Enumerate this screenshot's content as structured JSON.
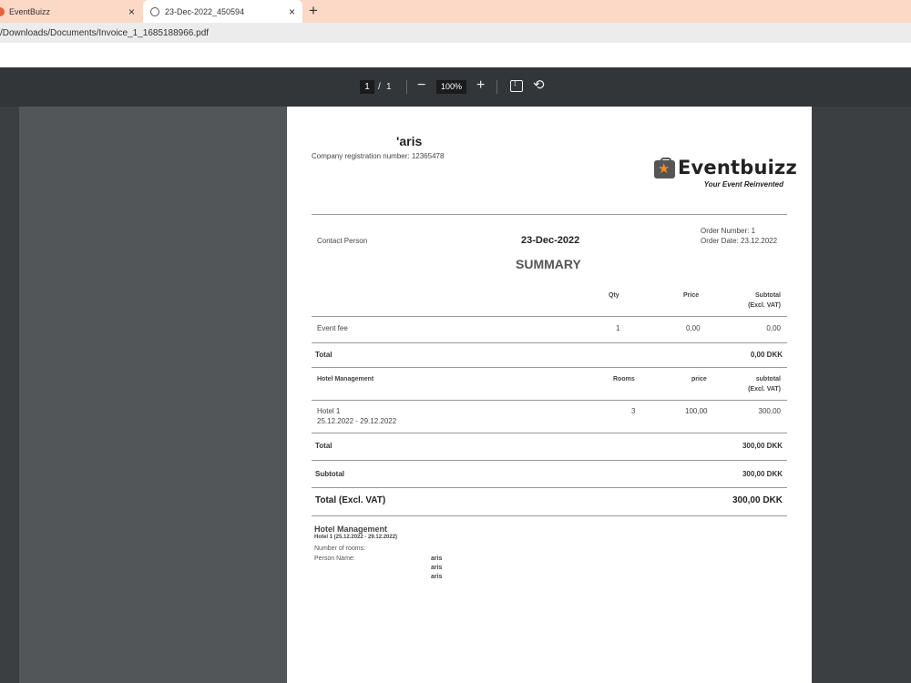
{
  "browser": {
    "tabs": [
      {
        "title": "EventBuizz"
      },
      {
        "title": "23-Dec-2022_450594"
      }
    ],
    "close_glyph": "×",
    "new_tab_glyph": "+",
    "url": "/Downloads/Documents/Invoice_1_1685188966.pdf"
  },
  "pdf_toolbar": {
    "page_current": "1",
    "page_separator": "/",
    "page_total": "1",
    "zoom_out_glyph": "−",
    "zoom": "100%",
    "zoom_in_glyph": "+",
    "rotate_glyph": "⟲"
  },
  "invoice": {
    "company_name": "'aris",
    "company_reg": "Company registration number: 12365478",
    "logo": {
      "name": "Eventbuizz",
      "tagline": "Your Event Reinvented",
      "star": "★"
    },
    "contact_person": "Contact Person",
    "date": "23-Dec-2022",
    "order_number": "Order Number: 1",
    "order_date": "Order Date: 23.12.2022",
    "summary_title": "SUMMARY",
    "event_table": {
      "headers": {
        "qty": "Qty",
        "price": "Price",
        "subtotal_1": "Subtotal",
        "subtotal_2": "(Excl. VAT)"
      },
      "row": {
        "item": "Event fee",
        "qty": "1",
        "price": "0,00",
        "subtotal": "0,00"
      },
      "total_label": "Total",
      "total_value": "0,00 DKK"
    },
    "hotel_table": {
      "headers": {
        "name": "Hotel Management",
        "rooms": "Rooms",
        "price": "price",
        "subtotal_1": "subtotal",
        "subtotal_2": "(Excl. VAT)"
      },
      "row": {
        "item": "Hotel 1",
        "dates": "25.12.2022 - 29.12.2022",
        "rooms": "3",
        "price": "100,00",
        "subtotal": "300,00"
      },
      "total_label": "Total",
      "total_value": "300,00 DKK"
    },
    "subtotal_label": "Subtotal",
    "subtotal_value": "300,00 DKK",
    "grand_total_label": "Total (Excl. VAT)",
    "grand_total_value": "300,00 DKK",
    "hotel_details": {
      "title": "Hotel Management",
      "subtitle": "Hotel 1 (25.12.2022 - 29.12.2022)",
      "rooms_label": "Number of rooms:",
      "person_label": "Person Name:",
      "persons": [
        "aris",
        "aris",
        "aris"
      ]
    }
  }
}
